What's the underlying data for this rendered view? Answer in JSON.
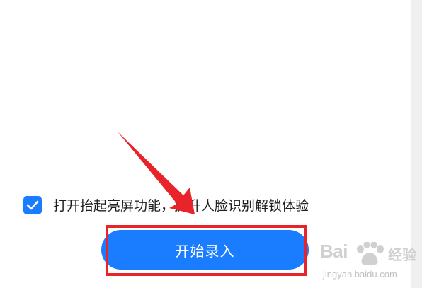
{
  "settings": {
    "raise_to_wake_label": "打开抬起亮屏功能，提升人脸识别解锁体验",
    "raise_to_wake_checked": true,
    "start_button_label": "开始录入"
  },
  "watermark": {
    "logo_left": "Bai",
    "logo_right": "经验",
    "url": "jingyan.baidu.com"
  },
  "colors": {
    "accent": "#1a7dff",
    "annotation_red": "#e8232a"
  }
}
